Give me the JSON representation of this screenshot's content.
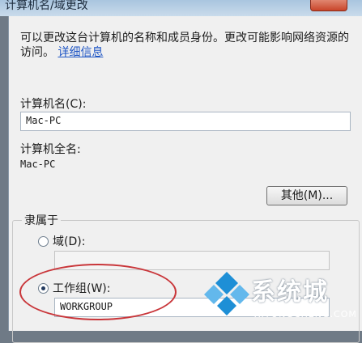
{
  "window": {
    "title": "计算机名/域更改"
  },
  "description": {
    "text": "可以更改这台计算机的名称和成员身份。更改可能影响网络资源的访问。",
    "link": "详细信息"
  },
  "computer_name": {
    "label": "计算机名(C):",
    "value": "Mac-PC"
  },
  "full_name": {
    "label": "计算机全名:",
    "value": "Mac-PC"
  },
  "more_button": {
    "label": "其他(M)..."
  },
  "member_of": {
    "label": "隶属于",
    "domain": {
      "label": "域(D):",
      "value": "",
      "selected": false
    },
    "workgroup": {
      "label": "工作组(W):",
      "value": "WORKGROUP",
      "selected": true
    }
  },
  "watermark": {
    "text": "系统城",
    "url": "XITONGCHENG.COM"
  },
  "colors": {
    "annotation": "#c9363a",
    "link": "#1e55c4",
    "watermark_blue": "#1e8fd6"
  }
}
